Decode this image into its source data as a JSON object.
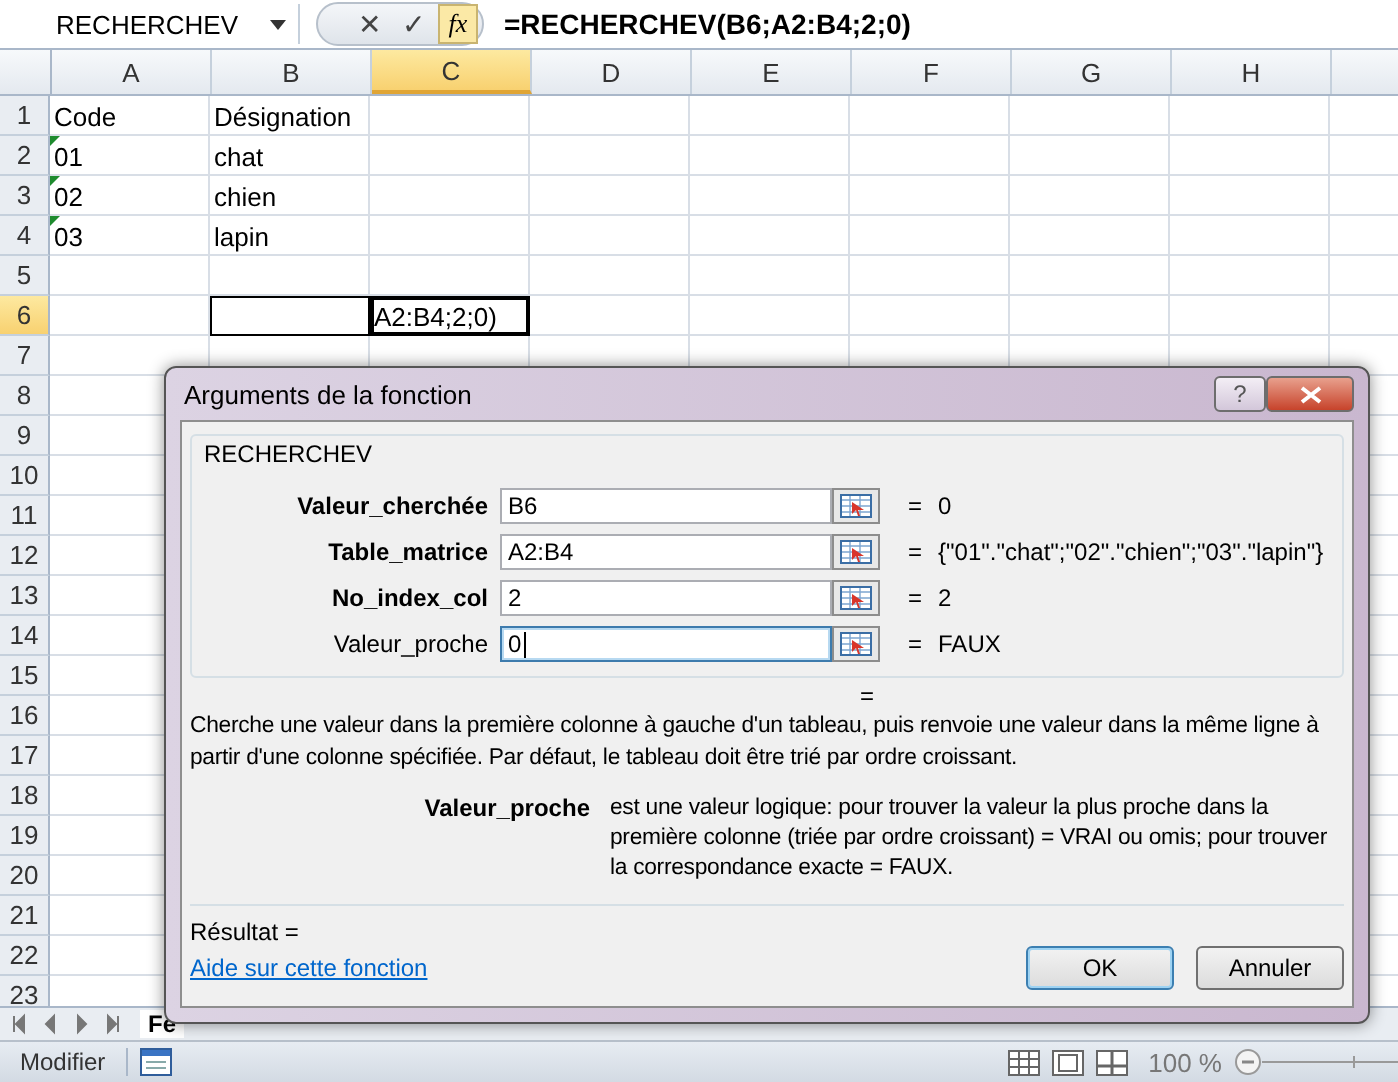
{
  "formula_bar": {
    "name_box": "RECHERCHEV",
    "cancel": "✕",
    "enter": "✓",
    "fx": "fx",
    "formula": "=RECHERCHEV(B6;A2:B4;2;0)"
  },
  "columns": [
    {
      "label": "A",
      "selected": false
    },
    {
      "label": "B",
      "selected": false
    },
    {
      "label": "C",
      "selected": true
    },
    {
      "label": "D",
      "selected": false
    },
    {
      "label": "E",
      "selected": false
    },
    {
      "label": "F",
      "selected": false
    },
    {
      "label": "G",
      "selected": false
    },
    {
      "label": "H",
      "selected": false
    }
  ],
  "rows": [
    {
      "label": "1",
      "selected": false,
      "cells": [
        {
          "text": "Code"
        },
        {
          "text": "Désignation"
        }
      ]
    },
    {
      "label": "2",
      "selected": false,
      "cells": [
        {
          "text": "01",
          "flagged": true
        },
        {
          "text": "chat"
        }
      ]
    },
    {
      "label": "3",
      "selected": false,
      "cells": [
        {
          "text": "02",
          "flagged": true
        },
        {
          "text": "chien"
        }
      ]
    },
    {
      "label": "4",
      "selected": false,
      "cells": [
        {
          "text": "03",
          "flagged": true
        },
        {
          "text": "lapin"
        }
      ]
    },
    {
      "label": "5",
      "selected": false,
      "cells": []
    },
    {
      "label": "6",
      "selected": true,
      "cells": [
        {},
        {
          "referenced": true
        },
        {
          "text": "A2:B4;2;0)",
          "active": true
        }
      ]
    },
    {
      "label": "7",
      "selected": false,
      "cells": []
    },
    {
      "label": "8",
      "selected": false,
      "cells": []
    },
    {
      "label": "9",
      "selected": false,
      "cells": []
    },
    {
      "label": "10",
      "selected": false,
      "cells": []
    },
    {
      "label": "11",
      "selected": false,
      "cells": []
    },
    {
      "label": "12",
      "selected": false,
      "cells": []
    },
    {
      "label": "13",
      "selected": false,
      "cells": []
    },
    {
      "label": "14",
      "selected": false,
      "cells": []
    },
    {
      "label": "15",
      "selected": false,
      "cells": []
    },
    {
      "label": "16",
      "selected": false,
      "cells": []
    },
    {
      "label": "17",
      "selected": false,
      "cells": []
    },
    {
      "label": "18",
      "selected": false,
      "cells": []
    },
    {
      "label": "19",
      "selected": false,
      "cells": []
    },
    {
      "label": "20",
      "selected": false,
      "cells": []
    },
    {
      "label": "21",
      "selected": false,
      "cells": []
    },
    {
      "label": "22",
      "selected": false,
      "cells": []
    },
    {
      "label": "23",
      "selected": false,
      "cells": []
    }
  ],
  "sheet_tabs": [
    {
      "label": "Fe",
      "selected": true
    }
  ],
  "status_bar": {
    "mode": "Modifier",
    "zoom": "100 %"
  },
  "dialog": {
    "title": "Arguments de la fonction",
    "help": "?",
    "function": "RECHERCHEV",
    "arguments": [
      {
        "name": "Valeur_cherchée",
        "required": true,
        "value": "B6",
        "equals": "=",
        "result": "0",
        "focused": false
      },
      {
        "name": "Table_matrice",
        "required": true,
        "value": "A2:B4",
        "equals": "=",
        "result": "{\"01\".\"chat\";\"02\".\"chien\";\"03\".\"lapin\"}",
        "focused": false
      },
      {
        "name": "No_index_col",
        "required": true,
        "value": "2",
        "equals": "=",
        "result": "2",
        "focused": false
      },
      {
        "name": "Valeur_proche",
        "required": false,
        "value": "0",
        "equals": "=",
        "result": "FAUX",
        "focused": true
      }
    ],
    "equals": "=",
    "description": "Cherche une valeur dans la première colonne à gauche d'un tableau, puis renvoie une valeur dans la même ligne à partir d'une colonne spécifiée. Par défaut, le tableau doit être trié par ordre croissant.",
    "argument_help": {
      "name": "Valeur_proche",
      "text": "est une valeur logique: pour trouver la valeur la plus proche dans la première colonne (triée par ordre croissant) = VRAI ou omis; pour trouver la correspondance exacte = FAUX."
    },
    "result_label": "Résultat =",
    "help_link": "Aide sur cette fonction",
    "buttons": [
      {
        "label": "OK",
        "default": true
      },
      {
        "label": "Annuler",
        "default": false
      }
    ]
  }
}
